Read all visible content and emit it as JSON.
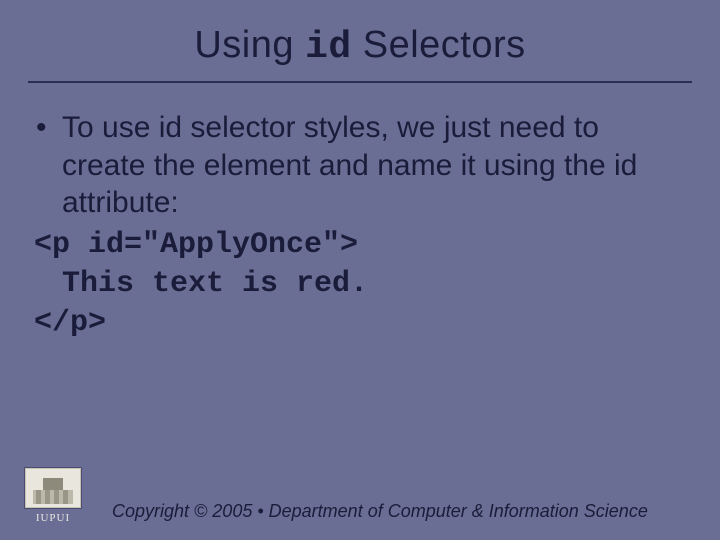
{
  "title": {
    "pre": "Using ",
    "code": "id",
    "post": " Selectors"
  },
  "bullet": {
    "mark": "•",
    "text": "To use id selector styles, we just need to create the element and name it using the id attribute:"
  },
  "code": {
    "line1": "<p id=\"ApplyOnce\">",
    "line2": "This text is red.",
    "line3": "</p>"
  },
  "footer": {
    "logo_label": "IUPUI",
    "copyright": "Copyright © 2005 • Department of Computer & Information Science"
  }
}
